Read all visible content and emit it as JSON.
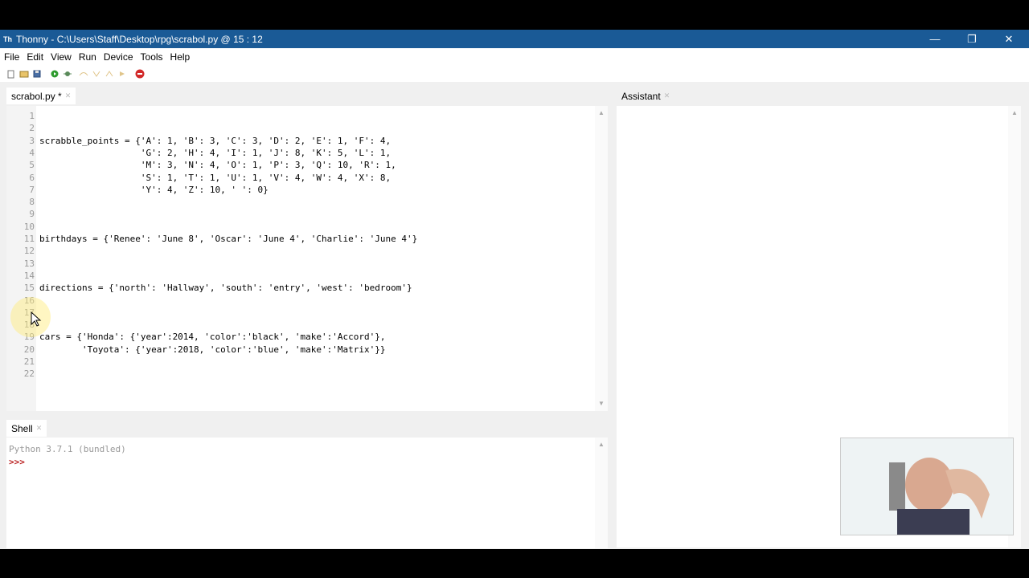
{
  "window": {
    "title": "Thonny  -  C:\\Users\\Staff\\Desktop\\rpg\\scrabol.py  @  15 : 12",
    "icon_glyph": "Th"
  },
  "menu": [
    "File",
    "Edit",
    "View",
    "Run",
    "Device",
    "Tools",
    "Help"
  ],
  "toolbar": [
    "new-file-icon",
    "open-file-icon",
    "save-icon",
    "run-icon",
    "debug-icon",
    "step-over-icon",
    "step-into-icon",
    "step-out-icon",
    "resume-icon",
    "stop-icon"
  ],
  "editor": {
    "tab_label": "scrabol.py *",
    "lines": [
      "",
      "",
      "scrabble_points = {'A': 1, 'B': 3, 'C': 3, 'D': 2, 'E': 1, 'F': 4,",
      "                   'G': 2, 'H': 4, 'I': 1, 'J': 8, 'K': 5, 'L': 1,",
      "                   'M': 3, 'N': 4, 'O': 1, 'P': 3, 'Q': 10, 'R': 1,",
      "                   'S': 1, 'T': 1, 'U': 1, 'V': 4, 'W': 4, 'X': 8,",
      "                   'Y': 4, 'Z': 10, ' ': 0}",
      "",
      "",
      "",
      "birthdays = {'Renee': 'June 8', 'Oscar': 'June 4', 'Charlie': 'June 4'}",
      "",
      "",
      "",
      "directions = {'north': 'Hallway', 'south': 'entry', 'west': 'bedroom'}",
      "",
      "",
      "",
      "cars = {'Honda': {'year':2014, 'color':'black', 'make':'Accord'},",
      "        'Toyota': {'year':2018, 'color':'blue', 'make':'Matrix'}}",
      "",
      ""
    ]
  },
  "shell": {
    "tab_label": "Shell",
    "banner": "Python 3.7.1 (bundled)",
    "prompt": ">>>"
  },
  "assistant": {
    "tab_label": "Assistant"
  },
  "colors": {
    "titlebar": "#1a5a96",
    "gutter": "#f4f4f4",
    "run_green": "#2e9b2e",
    "stop_red": "#d22a2a"
  }
}
